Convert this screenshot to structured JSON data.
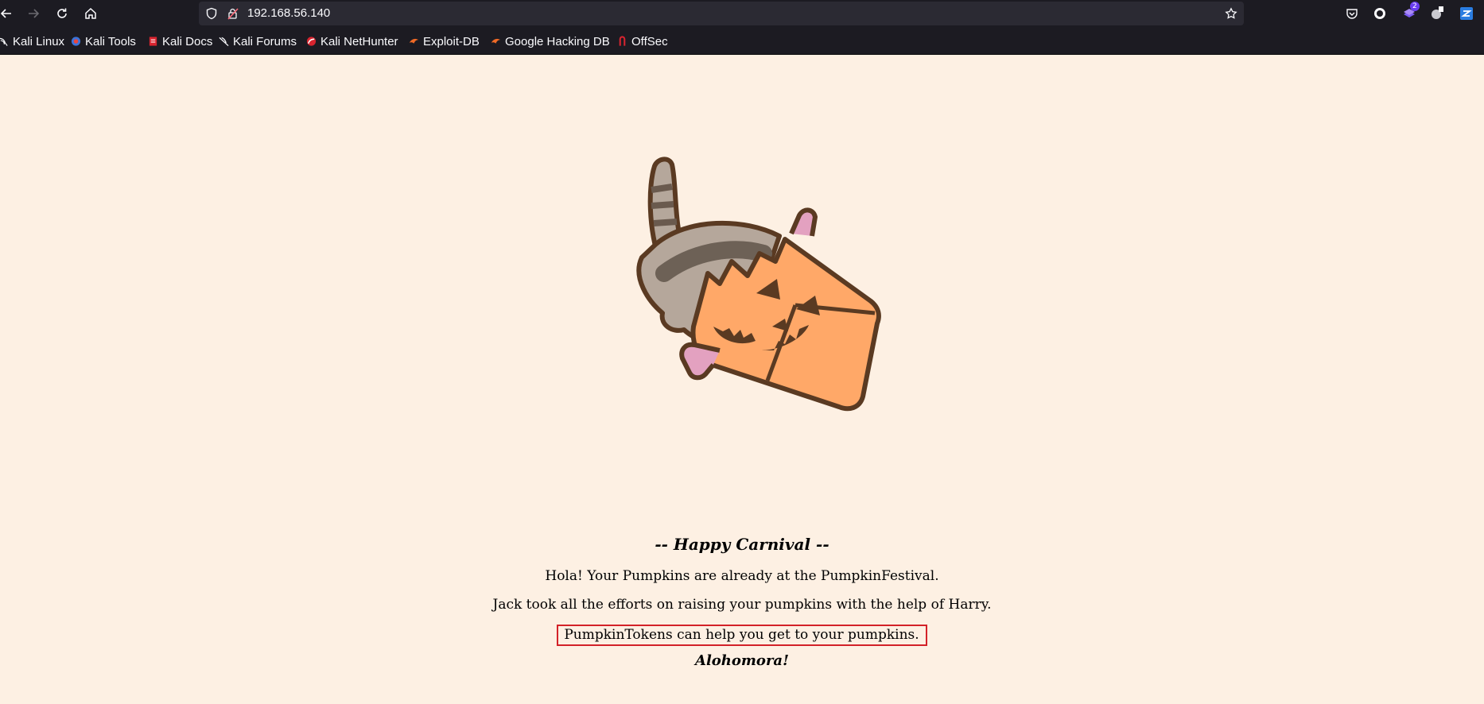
{
  "browser": {
    "url": "192.168.56.140",
    "extension_badge": "2",
    "bookmarks": [
      {
        "label": "Kali Linux",
        "icon": "kali-dragon-icon"
      },
      {
        "label": "Kali Tools",
        "icon": "kali-tools-icon"
      },
      {
        "label": "Kali Docs",
        "icon": "kali-docs-icon"
      },
      {
        "label": "Kali Forums",
        "icon": "kali-forums-icon"
      },
      {
        "label": "Kali NetHunter",
        "icon": "nethunter-icon"
      },
      {
        "label": "Exploit-DB",
        "icon": "exploit-db-icon"
      },
      {
        "label": "Google Hacking DB",
        "icon": "ghdb-icon"
      },
      {
        "label": "OffSec",
        "icon": "offsec-icon"
      }
    ]
  },
  "page": {
    "heading": "-- Happy Carnival --",
    "line1": "Hola! Your Pumpkins are already at the PumpkinFestival.",
    "line2": "Jack took all the efforts on raising your pumpkins with the help of Harry.",
    "line3": "PumpkinTokens can help you get to your pumpkins.",
    "closing": "Alohomora!"
  },
  "colors": {
    "page_background": "#fdf0e3",
    "highlight_border": "#d32128",
    "pumpkin_orange": "#ffa868",
    "outline_brown": "#5a3a22"
  }
}
